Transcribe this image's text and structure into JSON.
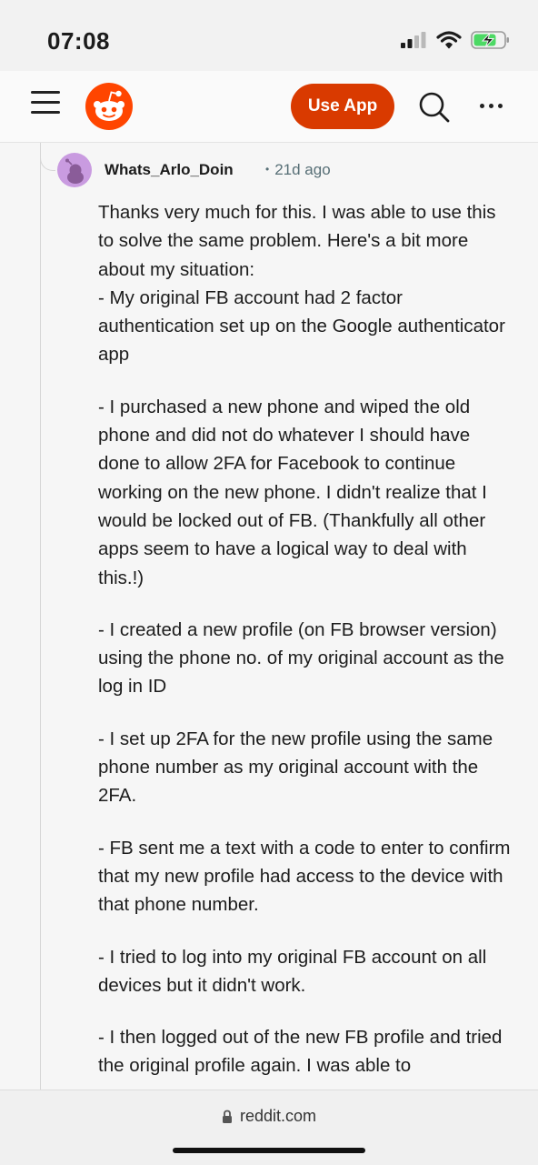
{
  "status_bar": {
    "time": "07:08"
  },
  "header": {
    "use_app_label": "Use App"
  },
  "comment": {
    "username": "Whats_Arlo_Doin",
    "separator": "•",
    "age": "21d ago",
    "paragraphs": [
      "Thanks very much for this. I was able to use this to solve the same problem. Here's a bit more about my situation:\n- My original FB account had 2 factor authentication set up on the Google authenticator app",
      "- I purchased a new phone and wiped the old phone and did not do whatever I should have done to allow 2FA for Facebook to continue working on the new phone. I didn't realize that I would be locked out of FB. (Thankfully all other apps seem to have a logical way to deal with this.!)",
      "- I created a new profile (on FB browser version) using the phone no. of my original account as the log in ID",
      "- I set up 2FA for the new profile using the same phone number as my original account with the 2FA.",
      "- FB sent me a text with a code to enter to confirm that my new profile had access to the device with that phone number.",
      "- I tried to log into my original FB account on all devices but it didn't work.",
      "- I then logged out of the new FB profile and tried the original profile again. I was able to"
    ]
  },
  "browser": {
    "url": "reddit.com"
  },
  "colors": {
    "accent": "#d93a00",
    "meta": "#576f76",
    "avatar": "#c99be0"
  },
  "icons": [
    "signal-icon",
    "wifi-icon",
    "battery-charging-icon",
    "menu-icon",
    "reddit-logo",
    "search-icon",
    "more-icon",
    "lock-icon"
  ]
}
